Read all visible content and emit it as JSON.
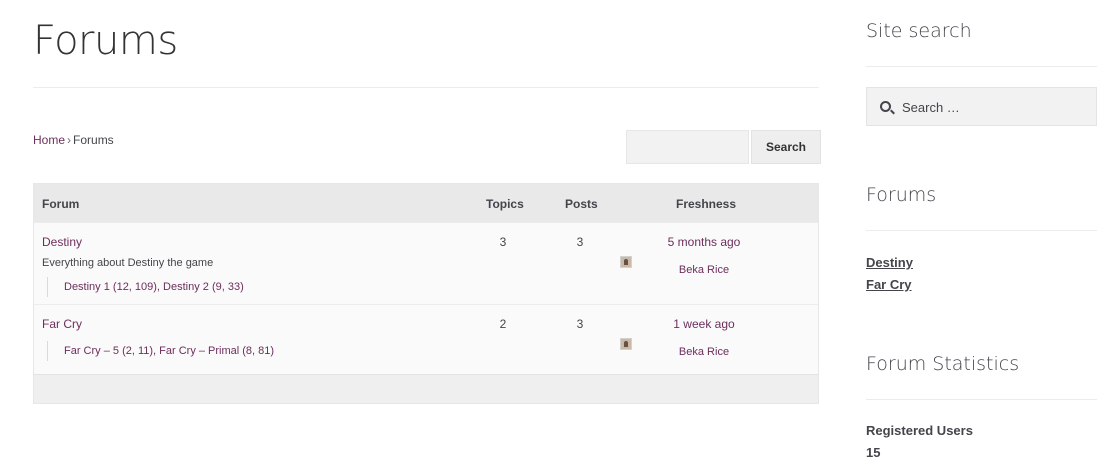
{
  "page": {
    "title": "Forums"
  },
  "breadcrumb": {
    "home": "Home",
    "separator": "›",
    "current": "Forums"
  },
  "forum_search": {
    "button_label": "Search",
    "value": ""
  },
  "table": {
    "headers": {
      "forum": "Forum",
      "topics": "Topics",
      "posts": "Posts",
      "freshness": "Freshness"
    },
    "rows": [
      {
        "name": "Destiny",
        "description": "Everything about Destiny the game",
        "subforums": "Destiny 1 (12, 109), Destiny 2 (9, 33)",
        "topics": "3",
        "posts": "3",
        "freshness": "5 months ago",
        "author": "Beka Rice"
      },
      {
        "name": "Far Cry",
        "description": "",
        "subforums": "Far Cry – 5 (2, 11), Far Cry – Primal (8, 81)",
        "topics": "2",
        "posts": "3",
        "freshness": "1 week ago",
        "author": "Beka Rice"
      }
    ]
  },
  "sidebar": {
    "search_title": "Site search",
    "search_placeholder": "Search …",
    "forums_title": "Forums",
    "forum_links": [
      "Destiny",
      "Far Cry"
    ],
    "stats_title": "Forum Statistics",
    "stats": {
      "label": "Registered Users",
      "value": "15"
    }
  },
  "colors": {
    "link": "#6d2e5c",
    "text": "#43454b",
    "header_bg": "#e9e9e9"
  },
  "icons": {
    "search": "search-icon",
    "avatar": "avatar"
  }
}
